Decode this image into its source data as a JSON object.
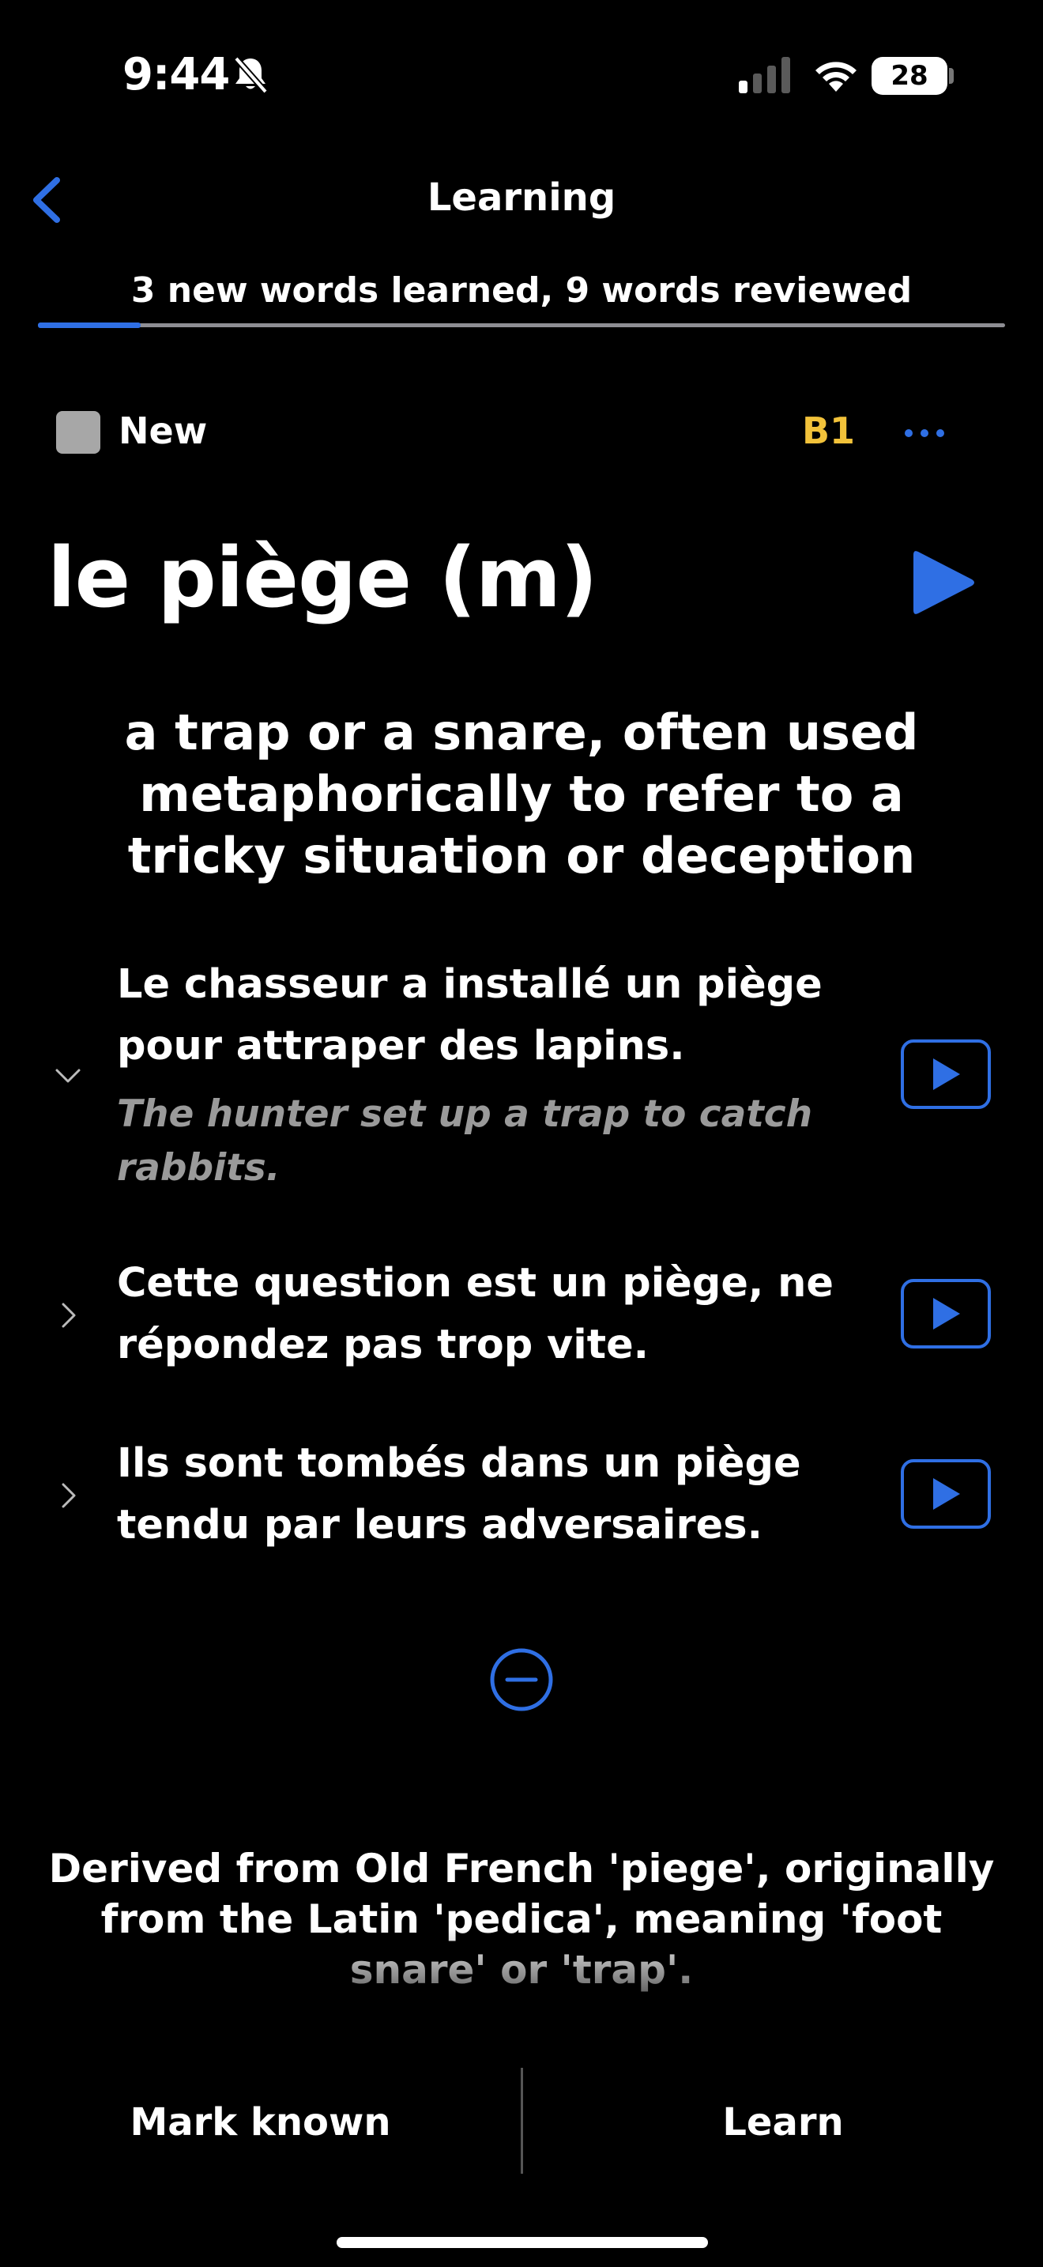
{
  "status_bar": {
    "time": "9:44",
    "battery": "28"
  },
  "nav": {
    "title": "Learning"
  },
  "progress": {
    "text": "3 new words learned, 9 words reviewed",
    "fraction": 0.106
  },
  "card": {
    "status_label": "New",
    "level": "B1",
    "word": "le piège (m)",
    "definition": "a trap or a snare, often used metaphorically to refer to a tricky situation or deception",
    "examples": [
      {
        "text": "Le chasseur a installé un piège pour attraper des lapins.",
        "translation": "The hunter set up a trap to catch rabbits.",
        "expanded": true
      },
      {
        "text": "Cette question est un piège, ne répondez pas trop vite.",
        "expanded": false
      },
      {
        "text": "Ils sont tombés dans un piège tendu par leurs adversaires.",
        "expanded": false
      }
    ],
    "etymology": "Derived from Old French 'piege', originally from the Latin 'pedica', meaning 'foot snare' or 'trap'."
  },
  "actions": {
    "mark_known": "Mark known",
    "learn": "Learn"
  },
  "colors": {
    "accent": "#2f6fe4",
    "level": "#f2c23a",
    "muted": "#9a9a9a"
  }
}
